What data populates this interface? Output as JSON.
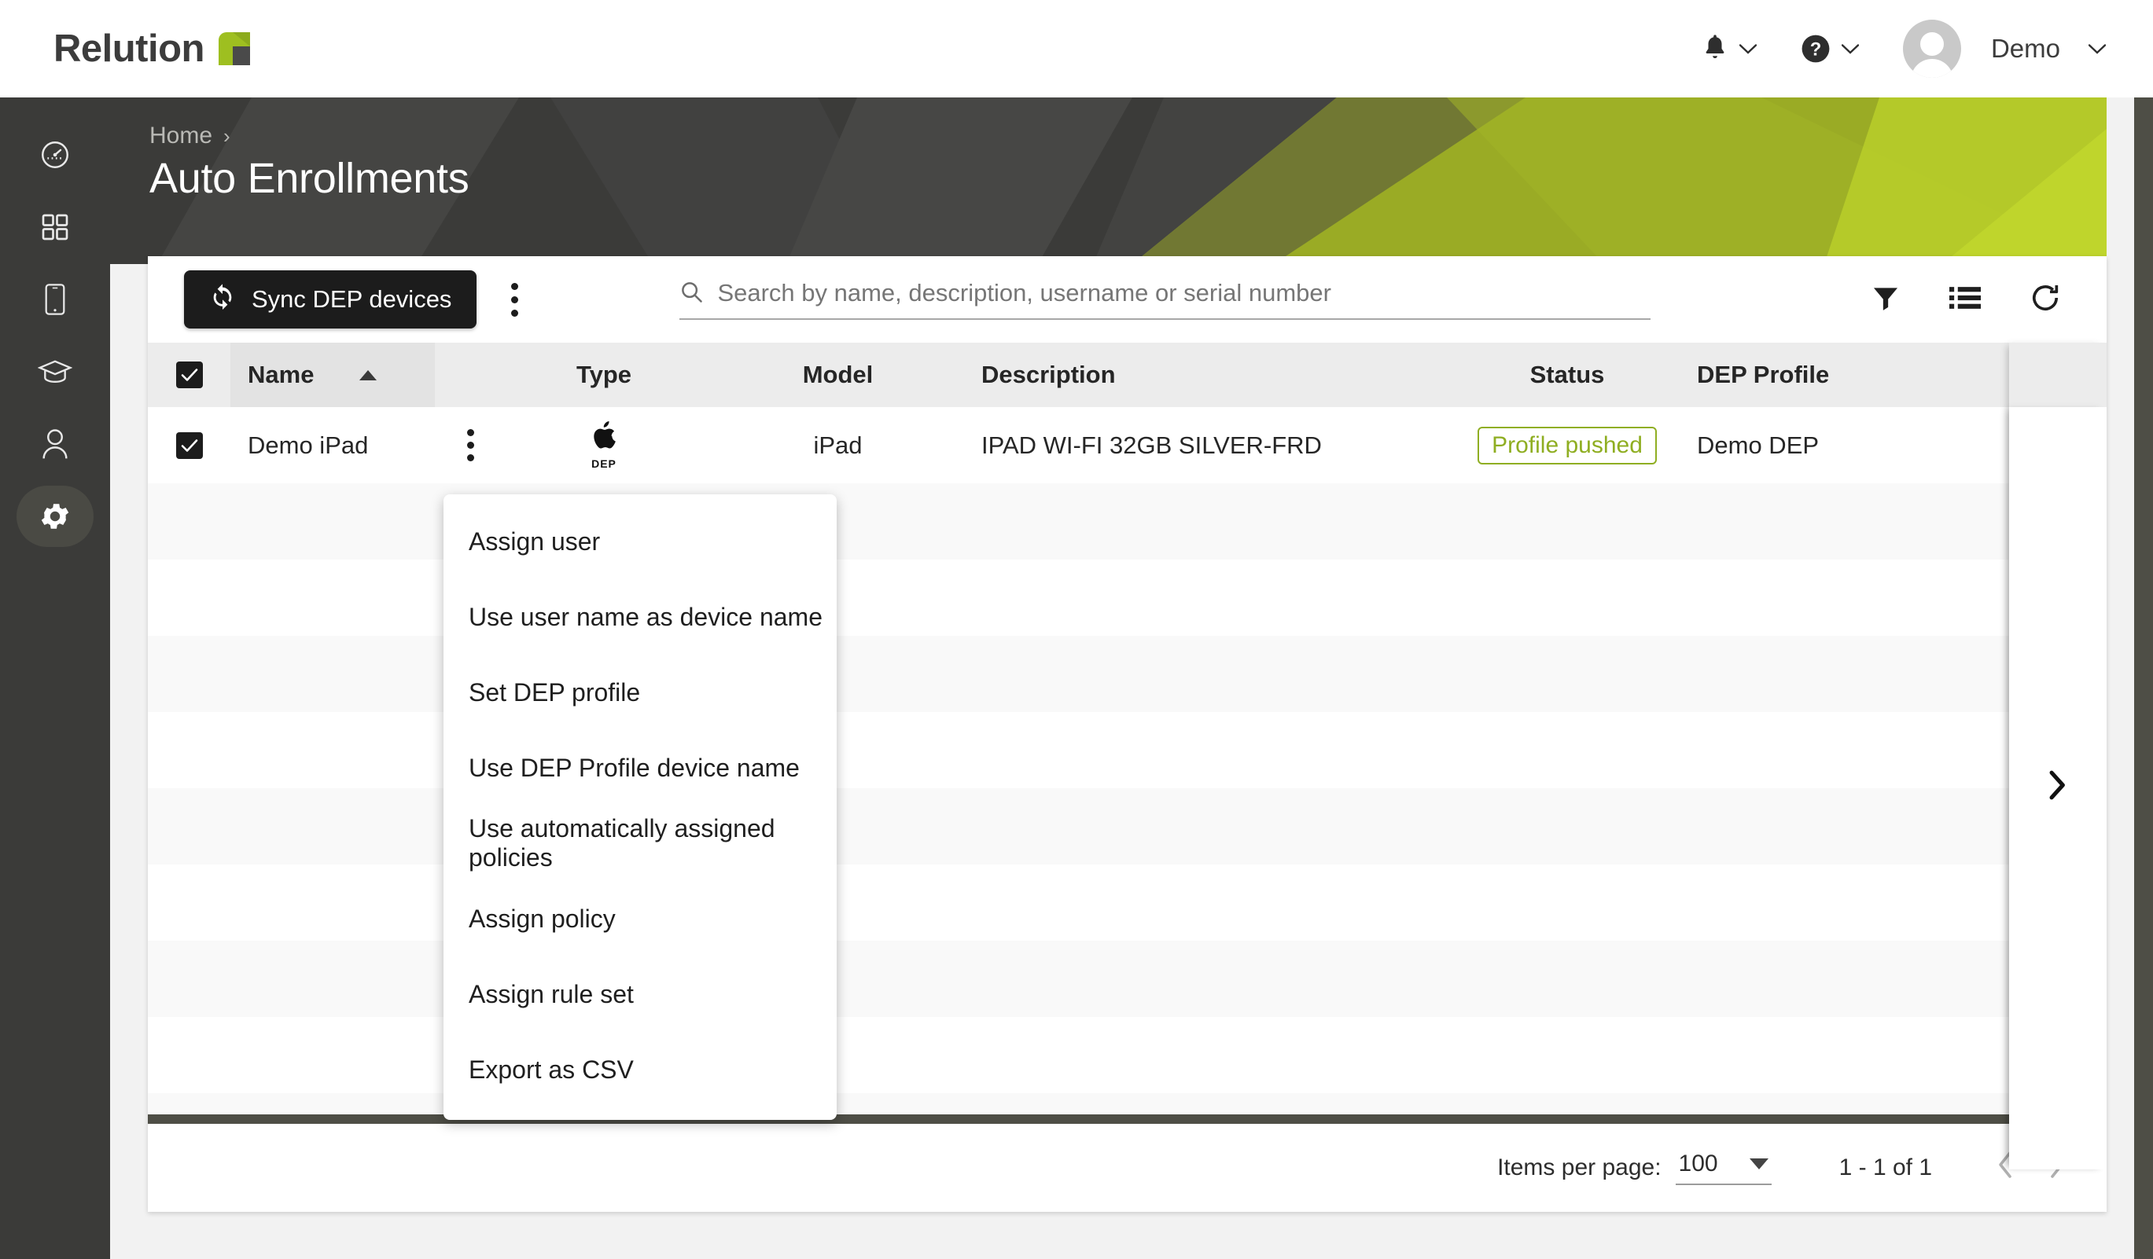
{
  "brand": {
    "name": "Relution",
    "logo_icon": "relution-logo-icon"
  },
  "topbar": {
    "notifications_icon": "bell-icon",
    "help_icon": "question-circle-icon",
    "chevron_icon": "chevron-down-icon",
    "avatar_icon": "avatar-icon",
    "user_name": "Demo"
  },
  "sidebar": {
    "items": [
      {
        "icon": "dashboard-speedometer-icon",
        "active": false
      },
      {
        "icon": "apps-grid-icon",
        "active": false
      },
      {
        "icon": "device-phone-icon",
        "active": false
      },
      {
        "icon": "graduation-cap-icon",
        "active": false
      },
      {
        "icon": "user-icon",
        "active": false
      },
      {
        "icon": "gear-icon",
        "active": true
      }
    ]
  },
  "hero": {
    "breadcrumb": "Home",
    "breadcrumb_separator": "›",
    "title": "Auto Enrollments"
  },
  "toolbar": {
    "sync_label": "Sync DEP devices",
    "sync_icon": "sync-refresh-icon",
    "kebab_icon": "more-vertical-icon",
    "search_icon": "search-icon",
    "search_placeholder": "Search by name, description, username or serial number",
    "search_value": "",
    "filter_icon": "filter-funnel-icon",
    "columns_icon": "list-view-icon",
    "refresh_icon": "refresh-icon"
  },
  "table": {
    "columns": [
      "Name",
      "Type",
      "Model",
      "Description",
      "Status",
      "DEP Profile"
    ],
    "sort_column": "Name",
    "sort_direction": "asc",
    "header_select_all_checked": true,
    "rows": [
      {
        "selected": true,
        "name": "Demo iPad",
        "row_menu_icon": "more-vertical-icon",
        "type_icon": "apple-logo-icon",
        "type_label": "DEP",
        "model": "iPad",
        "description": "IPAD WI-FI 32GB SILVER-FRD",
        "status": "Profile pushed",
        "status_color": "#8fae22",
        "dep_profile": "Demo DEP",
        "detail_arrow_icon": "chevron-right-icon"
      }
    ],
    "empty_row_count": 9
  },
  "context_menu": {
    "items": [
      "Assign user",
      "Use user name as device name",
      "Set DEP profile",
      "Use DEP Profile device name",
      "Use automatically assigned policies",
      "Assign policy",
      "Assign rule set",
      "Export as CSV"
    ]
  },
  "footer": {
    "items_per_page_label": "Items per page:",
    "items_per_page_value": "100",
    "caret_icon": "caret-down-icon",
    "range_label": "1 - 1 of 1",
    "prev_icon": "chevron-left-icon",
    "next_icon": "chevron-right-icon"
  },
  "colors": {
    "accent_green": "#9ebf20",
    "dark": "#3b3b39",
    "status_green": "#8fae22"
  }
}
